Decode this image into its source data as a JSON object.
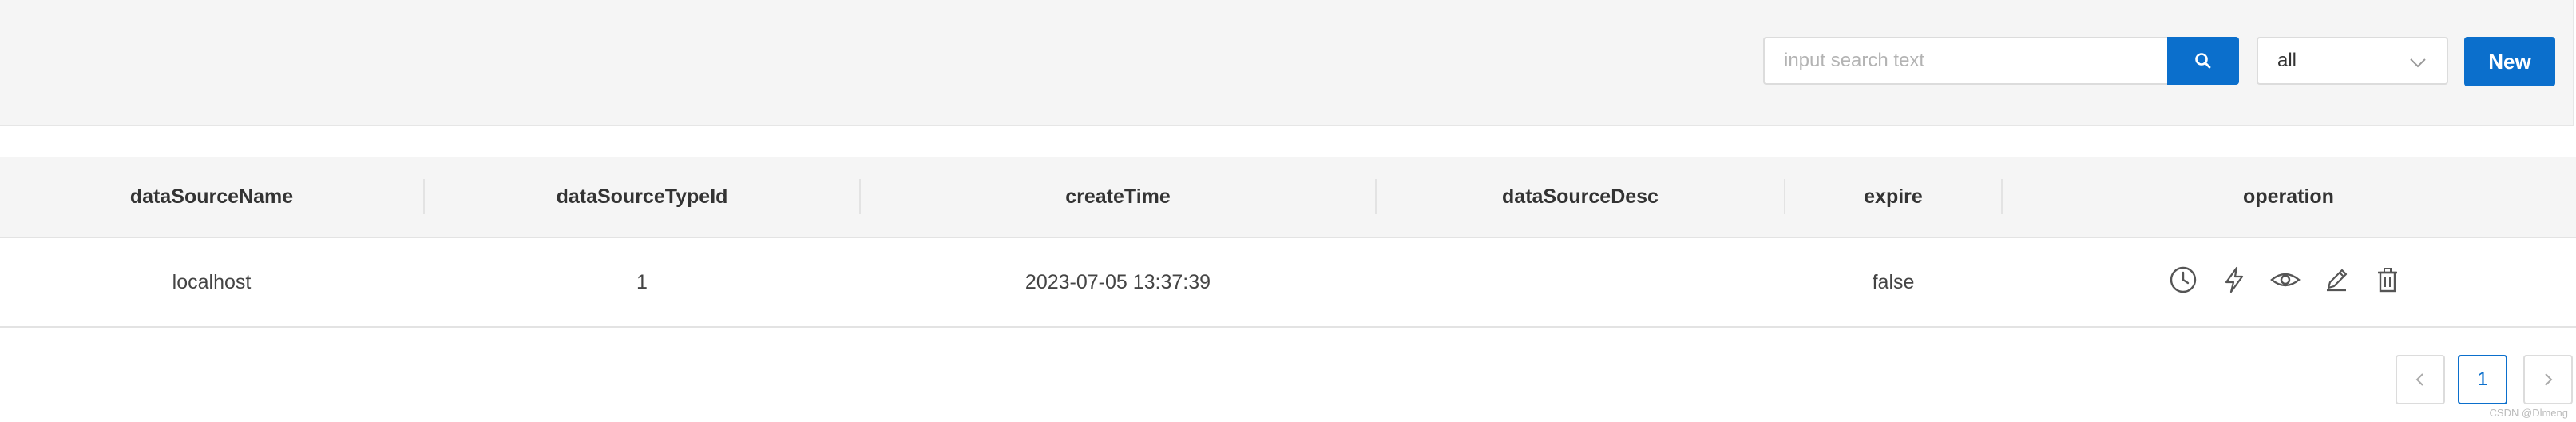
{
  "toolbar": {
    "search_placeholder": "input search text",
    "filter_value": "all",
    "new_label": "New"
  },
  "table": {
    "columns": [
      "dataSourceName",
      "dataSourceTypeId",
      "createTime",
      "dataSourceDesc",
      "expire",
      "operation"
    ],
    "rows": [
      {
        "dataSourceName": "localhost",
        "dataSourceTypeId": "1",
        "createTime": "2023-07-05 13:37:39",
        "dataSourceDesc": "",
        "expire": "false"
      }
    ],
    "operation_icons": [
      "clock-icon",
      "lightning-icon",
      "eye-icon",
      "pencil-icon",
      "trash-icon"
    ]
  },
  "pagination": {
    "current_page": "1"
  },
  "watermark": "CSDN @Dlmeng",
  "colors": {
    "primary": "#0b6fcc",
    "header_bg": "#f5f5f5",
    "border": "#e3e3e3"
  }
}
